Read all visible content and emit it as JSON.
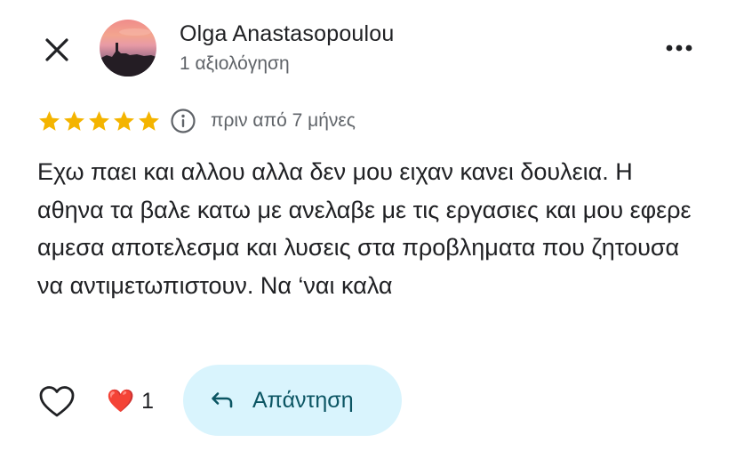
{
  "header": {
    "close_icon": "close-icon",
    "author_name": "Olga Anastasopoulou",
    "review_count": "1 αξιολόγηση",
    "more_icon": "more-horizontal-icon"
  },
  "rating": {
    "stars": 5,
    "max_stars": 5,
    "star_color": "#f4b400",
    "info_icon": "info-icon",
    "date": "πριν από 7 μήνες"
  },
  "review": {
    "text": "Εχω παει και αλλου αλλα δεν μου ειχαν κανει δουλεια. Η αθηνα τα βαλε κατω με ανελαβε με τις εργασιες και μου εφερε αμεσα αποτελεσμα και λυσεις στα προβληματα που ζητουσα να αντιμετωπιστουν. Να ‘ναι καλα"
  },
  "actions": {
    "like_icon": "heart-outline-icon",
    "reaction_emoji": "❤️",
    "reaction_count": "1",
    "reply_icon": "reply-arrow-icon",
    "reply_label": "Απάντηση",
    "reply_bg": "#d9f4fd",
    "reply_text_color": "#0b5563"
  }
}
